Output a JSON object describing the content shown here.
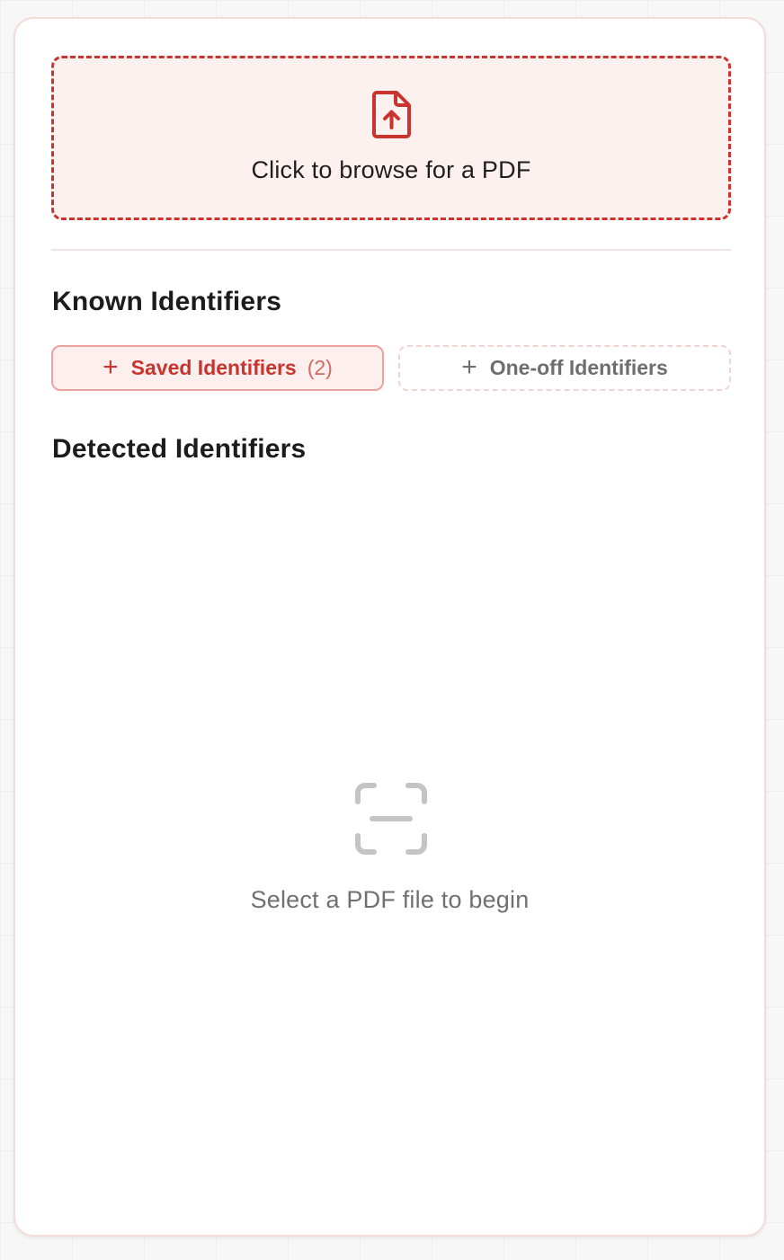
{
  "upload": {
    "label": "Click to browse for a PDF",
    "icon": "file-upload-icon"
  },
  "known_identifiers": {
    "title": "Known Identifiers",
    "saved_button": {
      "label": "Saved Identifiers",
      "count": "(2)",
      "icon": "plus-icon"
    },
    "oneoff_button": {
      "label": "One-off Identifiers",
      "icon": "plus-icon"
    }
  },
  "detected_identifiers": {
    "title": "Detected Identifiers",
    "empty_state": {
      "icon": "scan-icon",
      "message": "Select a PDF file to begin"
    }
  },
  "colors": {
    "accent": "#c9352e",
    "accent_bg": "#fcf1ef",
    "muted_text": "#707070",
    "icon_gray": "#c4c4c4"
  }
}
